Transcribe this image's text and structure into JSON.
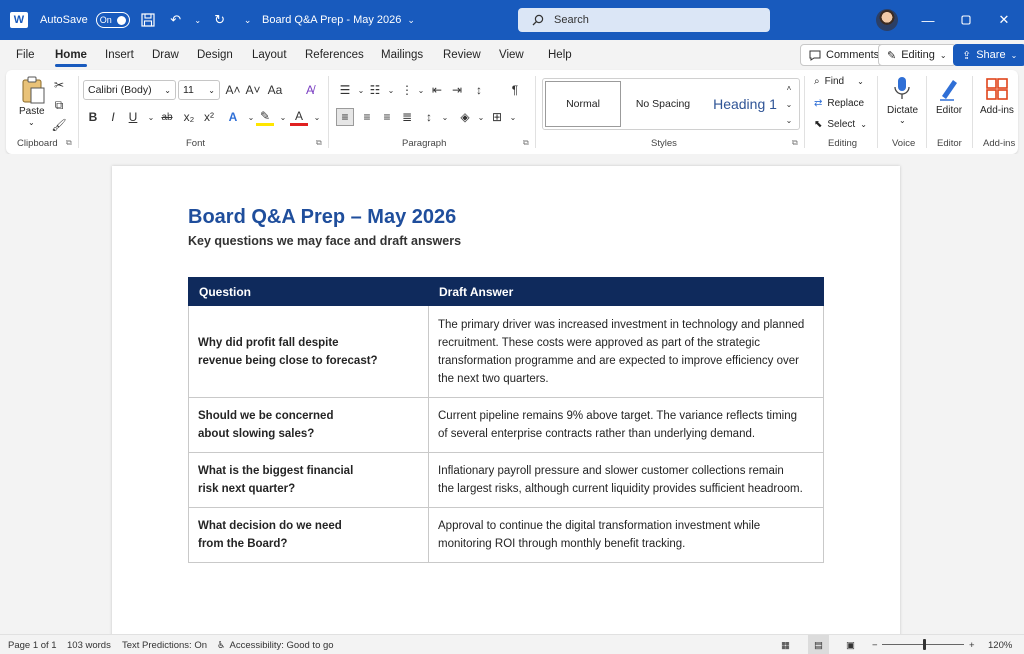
{
  "titlebar": {
    "app_logo": "W",
    "autosave_label": "AutoSave",
    "autosave_state": "On",
    "doc_title": "Board Q&A Prep - May 2026",
    "search_placeholder": "Search",
    "accent_color": "#185abd"
  },
  "menu": {
    "tabs": [
      "File",
      "Home",
      "Insert",
      "Draw",
      "Design",
      "Layout",
      "References",
      "Mailings",
      "Review",
      "View",
      "Help"
    ],
    "active_tab": "Home",
    "comments_label": "Comments",
    "editing_label": "Editing",
    "share_label": "Share"
  },
  "ribbon": {
    "clipboard": {
      "paste_label": "Paste",
      "group_label": "Clipboard"
    },
    "font": {
      "font_name": "Calibri (Body)",
      "font_size": "11",
      "group_label": "Font"
    },
    "paragraph": {
      "group_label": "Paragraph"
    },
    "styles": {
      "normal": "Normal",
      "no_spacing": "No Spacing",
      "heading1": "Heading 1",
      "group_label": "Styles"
    },
    "editing": {
      "find": "Find",
      "replace": "Replace",
      "select": "Select",
      "group_label": "Editing"
    },
    "voice": {
      "dictate": "Dictate",
      "group_label": "Voice"
    },
    "editor": {
      "editor": "Editor",
      "group_label": "Editor"
    },
    "addins": {
      "addins": "Add-ins",
      "group_label": "Add-ins"
    }
  },
  "document": {
    "title": "Board Q&A Prep – May 2026",
    "subtitle": "Key questions we may face and draft answers",
    "table": {
      "headers": [
        "Question",
        "Draft Answer"
      ],
      "header_color": "#0f2a5c",
      "rows": [
        {
          "question_lines": [
            "Why did profit fall despite",
            "revenue being close to forecast?"
          ],
          "answer_lines": [
            "The primary driver was increased investment in technology and planned",
            "recruitment. These costs were approved as part of the strategic",
            "transformation programme and are expected to improve efficiency over",
            "the next two quarters."
          ]
        },
        {
          "question_lines": [
            "Should we be concerned",
            "about slowing sales?"
          ],
          "answer_lines": [
            "Current pipeline remains 9% above target. The variance reflects timing",
            "of several enterprise contracts rather than underlying demand."
          ]
        },
        {
          "question_lines": [
            "What is the biggest financial",
            "risk next quarter?"
          ],
          "answer_lines": [
            "Inflationary payroll pressure and slower customer collections remain",
            "the largest risks, although current liquidity provides sufficient headroom."
          ]
        },
        {
          "question_lines": [
            "What decision do we need",
            "from the Board?"
          ],
          "answer_lines": [
            "Approval to continue the digital transformation investment while",
            "monitoring ROI through monthly benefit tracking."
          ]
        }
      ]
    }
  },
  "status": {
    "page": "Page 1 of 1",
    "words": "103 words",
    "text_predictions": "Text Predictions:  On",
    "accessibility": "Accessibility: Good to go",
    "zoom": "120%"
  }
}
